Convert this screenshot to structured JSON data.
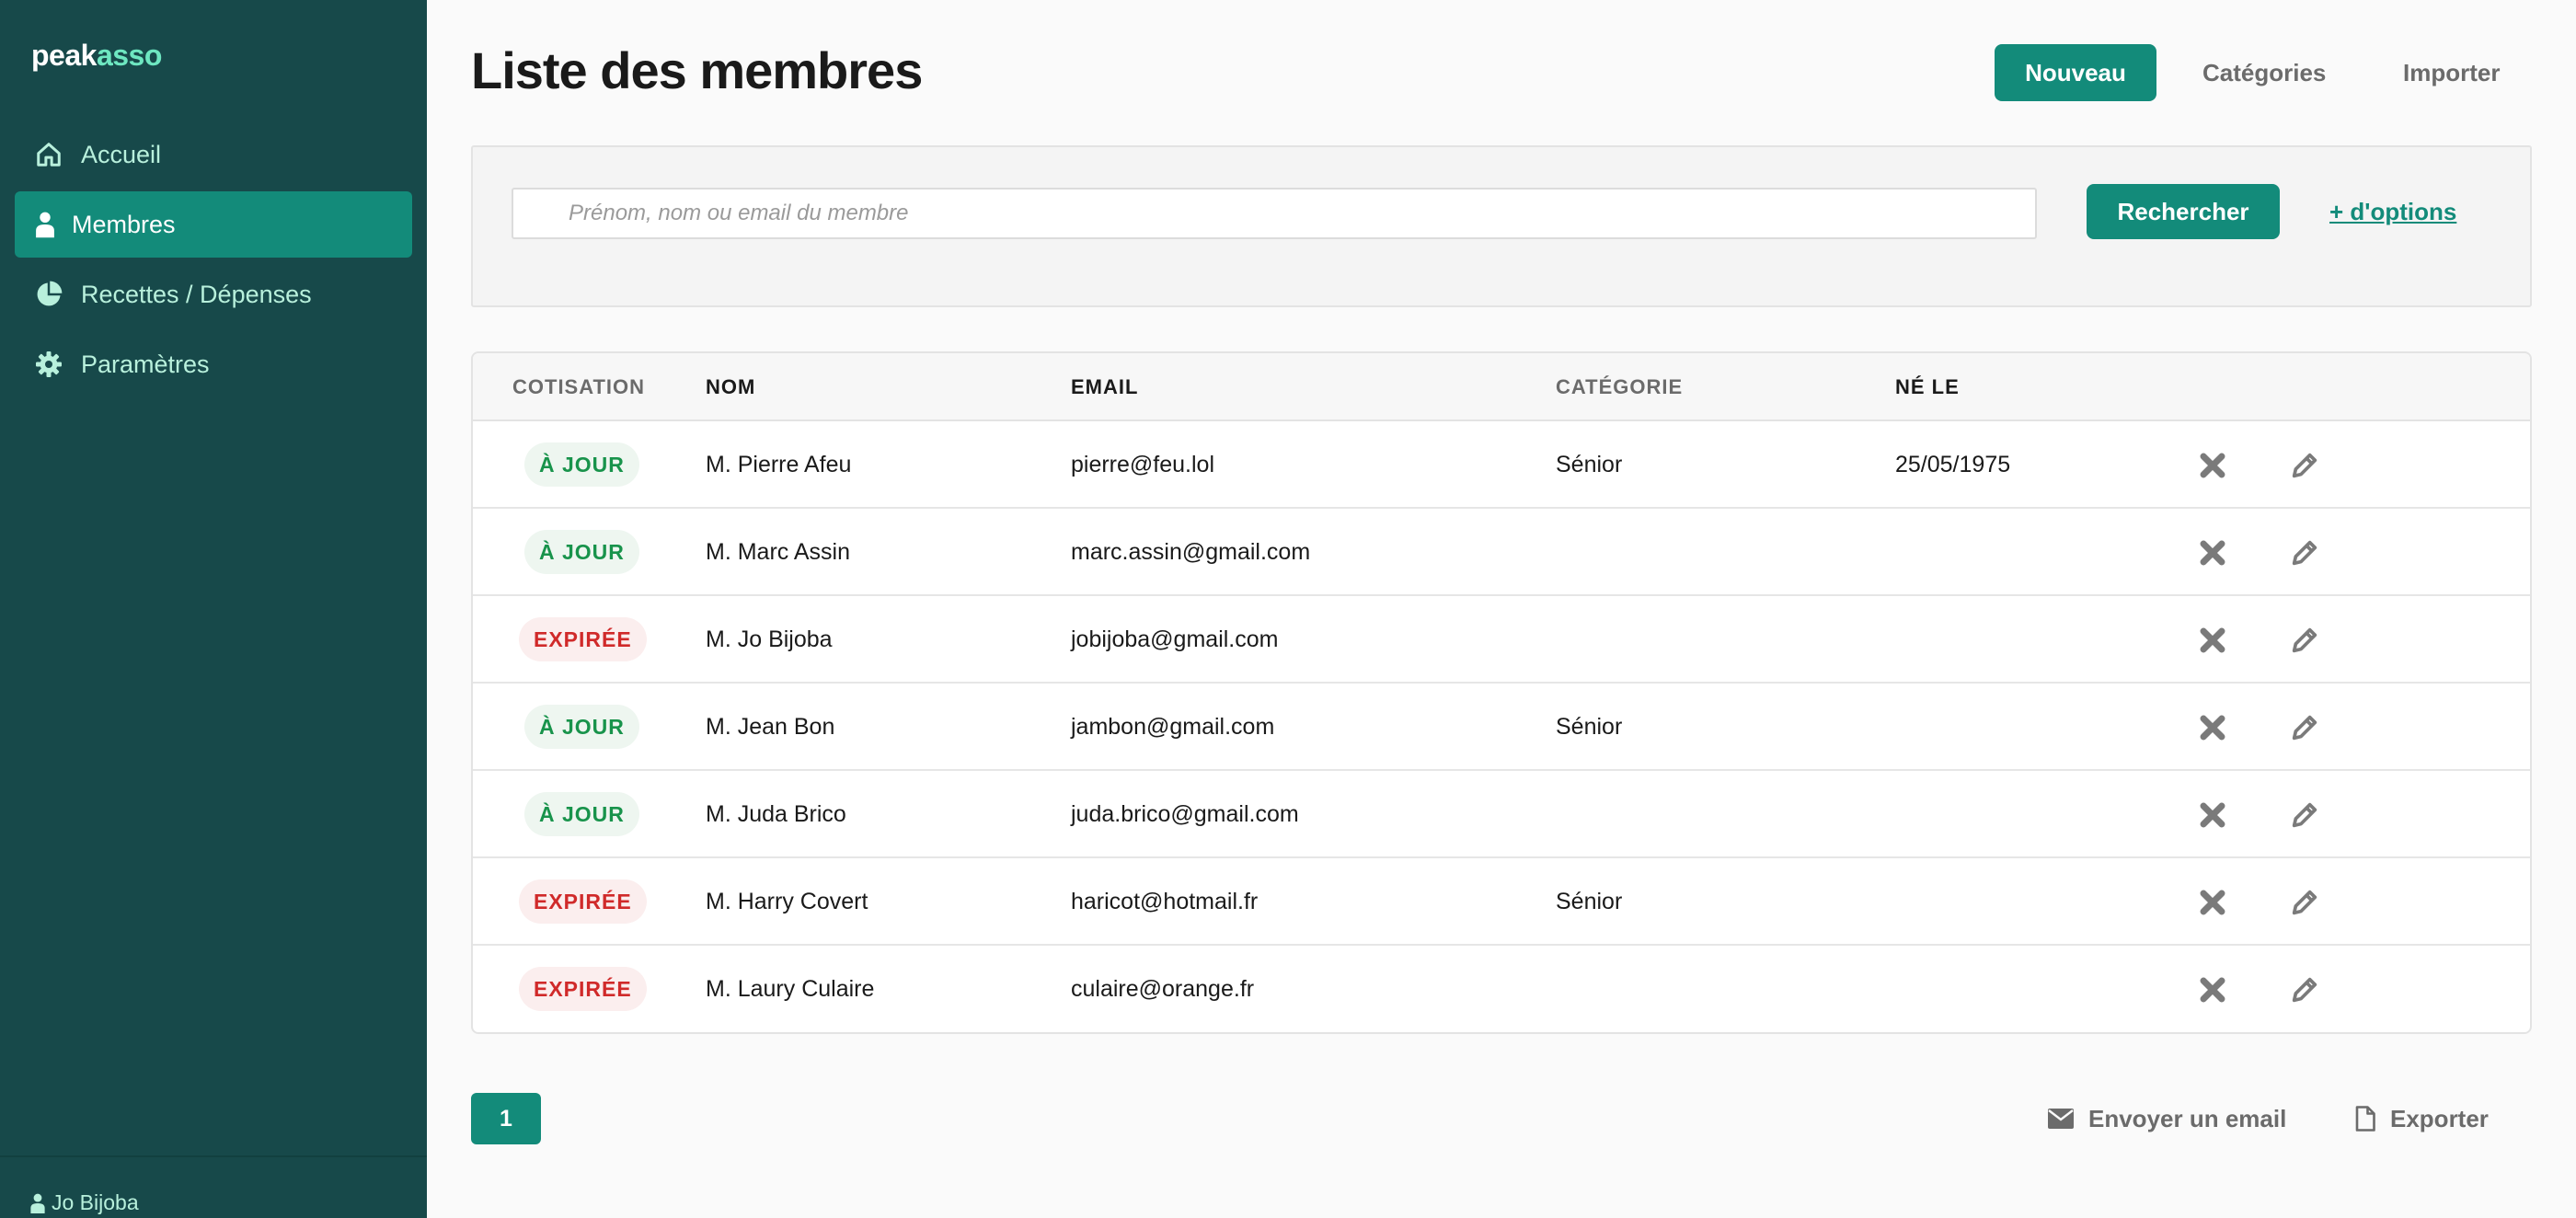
{
  "brand": {
    "part1": "peak",
    "part2": "asso"
  },
  "sidebar": {
    "items": [
      {
        "label": "Accueil",
        "icon": "home-icon"
      },
      {
        "label": "Membres",
        "icon": "user-icon",
        "active": true
      },
      {
        "label": "Recettes / Dépenses",
        "icon": "pie-chart-icon"
      },
      {
        "label": "Paramètres",
        "icon": "gear-icon"
      }
    ],
    "user": "Jo Bijoba"
  },
  "header": {
    "title": "Liste des membres",
    "new_label": "Nouveau",
    "categories_label": "Catégories",
    "import_label": "Importer"
  },
  "search": {
    "placeholder": "Prénom, nom ou email du membre",
    "button_label": "Rechercher",
    "options_label": "+ d'options"
  },
  "table": {
    "columns": {
      "cotisation": "COTISATION",
      "nom": "NOM",
      "email": "EMAIL",
      "categorie": "CATÉGORIE",
      "ne_le": "NÉ LE"
    },
    "rows": [
      {
        "status": "À JOUR",
        "ok": true,
        "name": "M. Pierre Afeu",
        "email": "pierre@feu.lol",
        "category": "Sénior",
        "birth": "25/05/1975"
      },
      {
        "status": "À JOUR",
        "ok": true,
        "name": "M. Marc Assin",
        "email": "marc.assin@gmail.com",
        "category": "",
        "birth": ""
      },
      {
        "status": "EXPIRÉE",
        "ok": false,
        "name": "M. Jo Bijoba",
        "email": "jobijoba@gmail.com",
        "category": "",
        "birth": ""
      },
      {
        "status": "À JOUR",
        "ok": true,
        "name": "M. Jean Bon",
        "email": "jambon@gmail.com",
        "category": "Sénior",
        "birth": ""
      },
      {
        "status": "À JOUR",
        "ok": true,
        "name": "M. Juda Brico",
        "email": "juda.brico@gmail.com",
        "category": "",
        "birth": ""
      },
      {
        "status": "EXPIRÉE",
        "ok": false,
        "name": "M. Harry Covert",
        "email": "haricot@hotmail.fr",
        "category": "Sénior",
        "birth": ""
      },
      {
        "status": "EXPIRÉE",
        "ok": false,
        "name": "M. Laury Culaire",
        "email": "culaire@orange.fr",
        "category": "",
        "birth": ""
      }
    ]
  },
  "footer": {
    "page": "1",
    "send_email_label": "Envoyer un email",
    "export_label": "Exporter"
  },
  "colors": {
    "sidebar_bg": "#17494a",
    "accent": "#138b7a",
    "status_ok": "#18934b",
    "status_expired": "#d02a2a"
  }
}
